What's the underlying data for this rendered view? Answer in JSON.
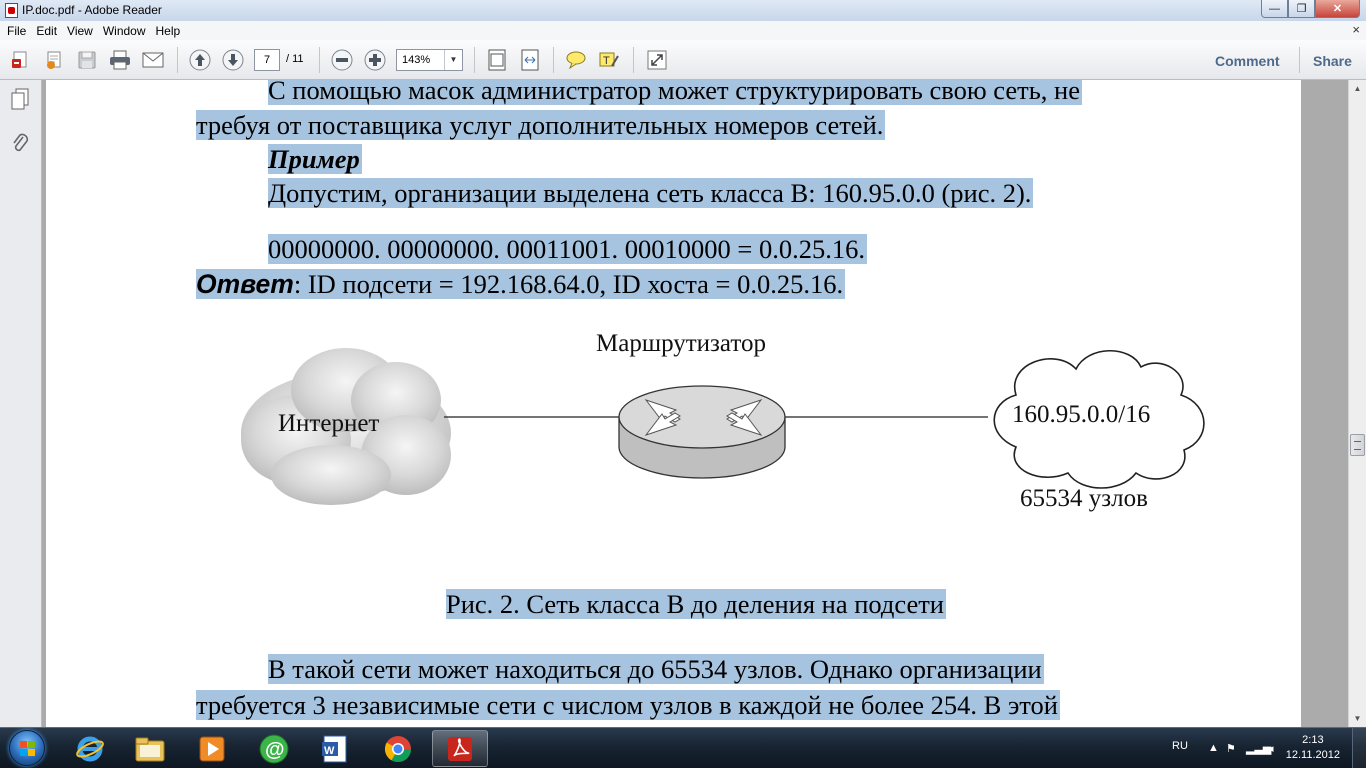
{
  "window": {
    "title": "IP.doc.pdf - Adobe Reader",
    "buttons": {
      "minimize": "—",
      "maximize": "❐",
      "close": "✕"
    }
  },
  "menu": {
    "items": [
      "File",
      "Edit",
      "View",
      "Window",
      "Help"
    ],
    "close_glyph": "×"
  },
  "toolbar": {
    "page_current": "7",
    "page_total": "/ 11",
    "zoom": "143%",
    "comment_label": "Comment",
    "share_label": "Share"
  },
  "document": {
    "para1_line1": "С помощью масок администратор может структурировать свою сеть, не",
    "para1_line2": "требуя от поставщика услуг дополнительных номеров сетей.",
    "example_heading": "Пример",
    "example_text": "Допустим, организации выделена сеть класса В: 160.95.0.0 (рис. 2).",
    "binary_line": "00000000. 00000000. 00011001. 00010000 = 0.0.25.16.",
    "answer_label": "Ответ",
    "answer_text": ": ID подсети = 192.168.64.0, ID хоста = 0.0.25.16.",
    "figure": {
      "router_label": "Маршрутизатор",
      "internet_label": "Интернет",
      "network_label": "160.95.0.0/16",
      "hosts_label": "65534 узлов"
    },
    "figure_caption": "Рис. 2. Сеть класса В до деления на подсети",
    "para2_line1": "В такой сети может находиться до 65534 узлов. Однако организации",
    "para2_line2": "требуется 3 независимые сети с числом узлов в каждой не более 254. В этой"
  },
  "taskbar": {
    "language": "RU",
    "time": "2:13",
    "date": "12.11.2012"
  },
  "colors": {
    "highlight": "#a6c3df",
    "title_bar": "#c7d6ea",
    "taskbar": "#182432"
  }
}
